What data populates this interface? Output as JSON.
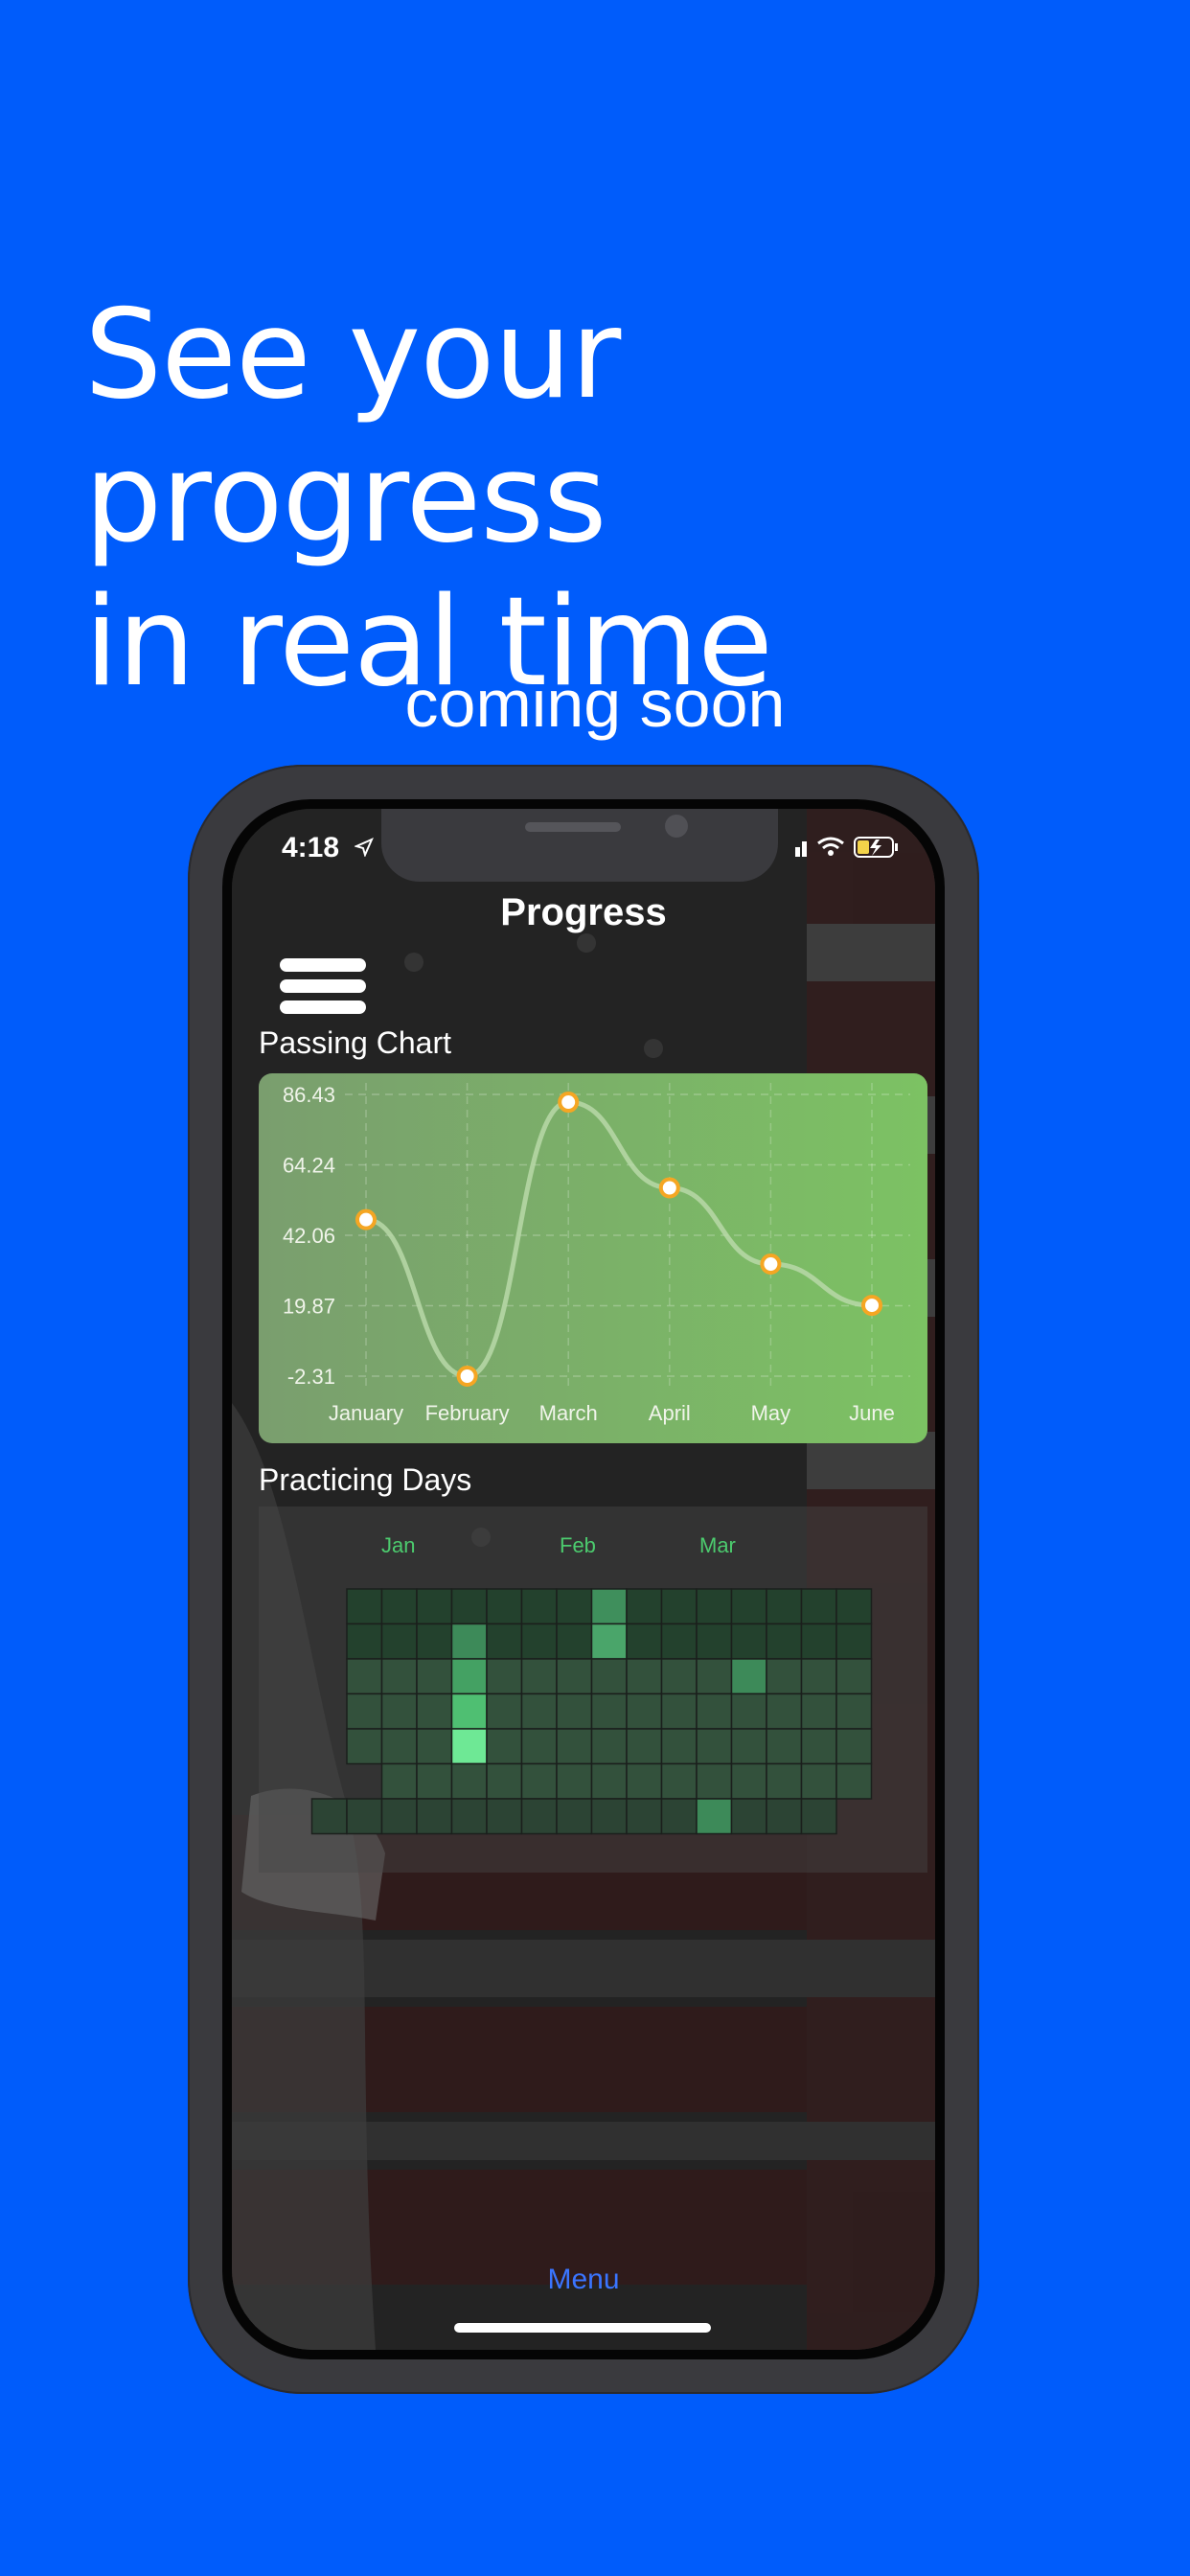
{
  "headline": {
    "line1": "See your progress",
    "line2": "in real time"
  },
  "subline": "coming soon",
  "status": {
    "time": "4:18"
  },
  "nav": {
    "title": "Progress"
  },
  "sections": {
    "passing_chart": "Passing Chart",
    "practicing_days": "Practicing Days"
  },
  "heatmap": {
    "months": [
      "Jan",
      "Feb",
      "Mar"
    ]
  },
  "tabbar": {
    "menu_label": "Menu"
  },
  "colors": {
    "background": "#005cfb",
    "chart_line": "#b9d8a8",
    "point": "#f5a623",
    "heat_accent": "#4ccb6e",
    "tab_accent": "#3a75ff"
  },
  "chart_data": {
    "type": "line",
    "title": "Passing Chart",
    "categories": [
      "January",
      "February",
      "March",
      "April",
      "May",
      "June"
    ],
    "values": [
      47,
      -2.31,
      84,
      57,
      33,
      20
    ],
    "y_ticks": [
      "86.43",
      "64.24",
      "42.06",
      "19.87",
      "-2.31"
    ],
    "ylim": [
      -2.31,
      86.43
    ],
    "grid": true
  }
}
